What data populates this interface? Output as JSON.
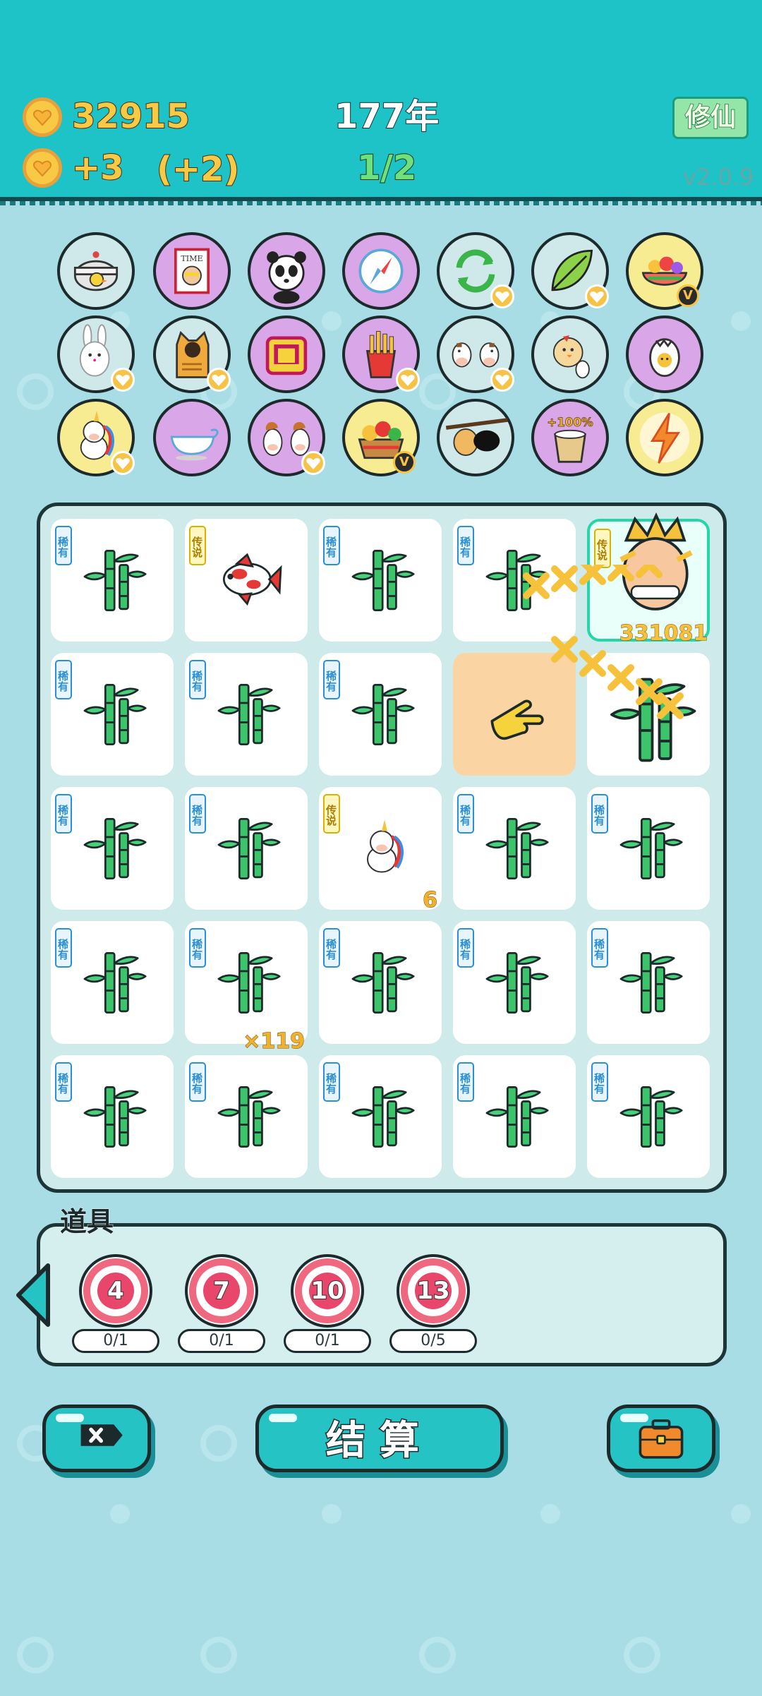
{
  "header": {
    "coins": "32915",
    "income": "+3",
    "income_bonus": "(+2)",
    "year": "177年",
    "progress": "1/2",
    "mode_button": "修仙",
    "version": "v2.0.9"
  },
  "items": [
    {
      "name": "duck-pot",
      "bg": "#cfe9ea",
      "badge": "none"
    },
    {
      "name": "time-magazine",
      "bg": "#d9a7e8",
      "badge": "none"
    },
    {
      "name": "panda",
      "bg": "#d9a7e8",
      "badge": "none"
    },
    {
      "name": "compass",
      "bg": "#d9a7e8",
      "badge": "none"
    },
    {
      "name": "recycle",
      "bg": "#cfe9ea",
      "badge": "heart"
    },
    {
      "name": "leaf",
      "bg": "#cfe9ea",
      "badge": "heart"
    },
    {
      "name": "fruit-bowl",
      "bg": "#f8ec92",
      "badge": "v"
    },
    {
      "name": "rabbit",
      "bg": "#cfe9ea",
      "badge": "heart"
    },
    {
      "name": "cat",
      "bg": "#cfe9ea",
      "badge": "heart"
    },
    {
      "name": "toaster",
      "bg": "#d9a7e8",
      "badge": "none"
    },
    {
      "name": "fries",
      "bg": "#d9a7e8",
      "badge": "heart"
    },
    {
      "name": "cows",
      "bg": "#cfe9ea",
      "badge": "heart"
    },
    {
      "name": "chick-egg",
      "bg": "#cfe9ea",
      "badge": "none"
    },
    {
      "name": "egg",
      "bg": "#d9a7e8",
      "badge": "none"
    },
    {
      "name": "unicorn",
      "bg": "#f8ec92",
      "badge": "heart"
    },
    {
      "name": "gravy-boat",
      "bg": "#d9a7e8",
      "badge": "none"
    },
    {
      "name": "horses",
      "bg": "#d9a7e8",
      "badge": "heart"
    },
    {
      "name": "fruit-basket",
      "bg": "#f8ec92",
      "badge": "v"
    },
    {
      "name": "eyepatch",
      "bg": "#cfe9ea",
      "badge": "none"
    },
    {
      "name": "bucket-100",
      "bg": "#d9a7e8",
      "badge": "none",
      "label": "+100%"
    },
    {
      "name": "lightning",
      "bg": "#f8ec92",
      "badge": "none"
    }
  ],
  "tags": {
    "rare": "稀有",
    "legend": "传说"
  },
  "board_counts": {
    "unicorn": "6",
    "bamboo": "×119",
    "partial": "331081"
  },
  "props": {
    "title": "道具",
    "items": [
      {
        "value": "4",
        "count": "0/1"
      },
      {
        "value": "7",
        "count": "0/1"
      },
      {
        "value": "10",
        "count": "0/1"
      },
      {
        "value": "13",
        "count": "0/5"
      }
    ]
  },
  "buttons": {
    "settle": "结算"
  },
  "colors": {
    "header": "#1dc3c6",
    "accent": "#26c3c5",
    "coin": "#f7c944",
    "background": "#a9dde5"
  }
}
